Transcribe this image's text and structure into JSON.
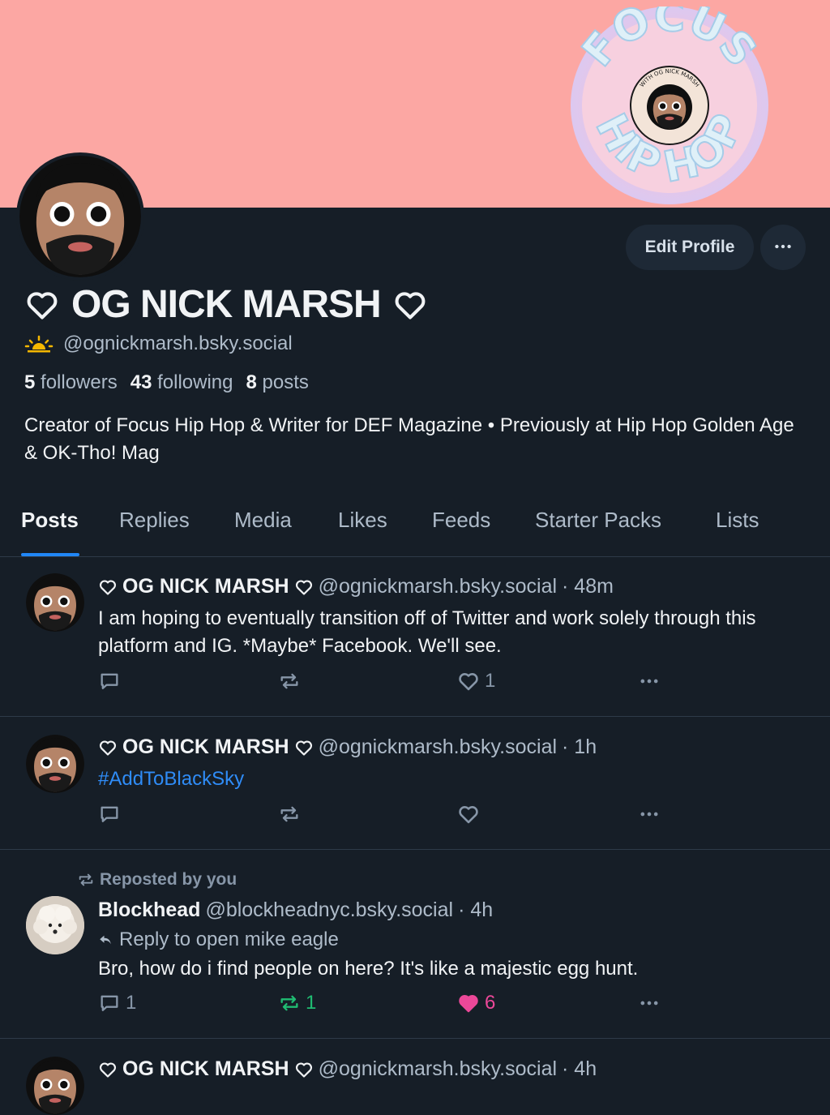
{
  "profile": {
    "display_name": "OG NICK MARSH",
    "handle": "@ognickmarsh.bsky.social",
    "followers_count": "5",
    "followers_label": "followers",
    "following_count": "43",
    "following_label": "following",
    "posts_count": "8",
    "posts_label": "posts",
    "bio": "Creator of Focus Hip Hop & Writer for DEF Magazine • Previously at Hip Hop Golden Age & OK-Tho! Mag",
    "edit_label": "Edit Profile",
    "badge_text_outer": "FOCUS HIP HOP",
    "badge_text_inner": "WITH OG NICK MARSH",
    "banner_color": "#fca7a3",
    "accent_color": "#2187f7"
  },
  "tabs": [
    {
      "label": "Posts",
      "active": true
    },
    {
      "label": "Replies"
    },
    {
      "label": "Media"
    },
    {
      "label": "Likes"
    },
    {
      "label": "Feeds"
    },
    {
      "label": "Starter Packs"
    },
    {
      "label": "Lists"
    }
  ],
  "posts": [
    {
      "author": "OG NICK MARSH",
      "handle": "@ognickmarsh.bsky.social",
      "time": "· 48m",
      "text": "I am hoping to eventually transition off of Twitter and work solely through this platform and IG. *Maybe* Facebook. We'll see.",
      "likes": "1"
    },
    {
      "author": "OG NICK MARSH",
      "handle": "@ognickmarsh.bsky.social",
      "time": "· 1h",
      "text": "#AddToBlackSky"
    },
    {
      "repost_label": "Reposted by you",
      "author": "Blockhead",
      "handle": "@blockheadnyc.bsky.social",
      "time": "· 4h",
      "reply_to": "Reply to open mike eagle",
      "text": "Bro, how do i find people on here? It's like a majestic egg hunt.",
      "replies": "1",
      "reposts": "1",
      "likes": "6",
      "repost_color": "#20bc72",
      "like_color": "#ec4899"
    },
    {
      "author": "OG NICK MARSH",
      "handle": "@ognickmarsh.bsky.social",
      "time": "· 4h"
    }
  ]
}
